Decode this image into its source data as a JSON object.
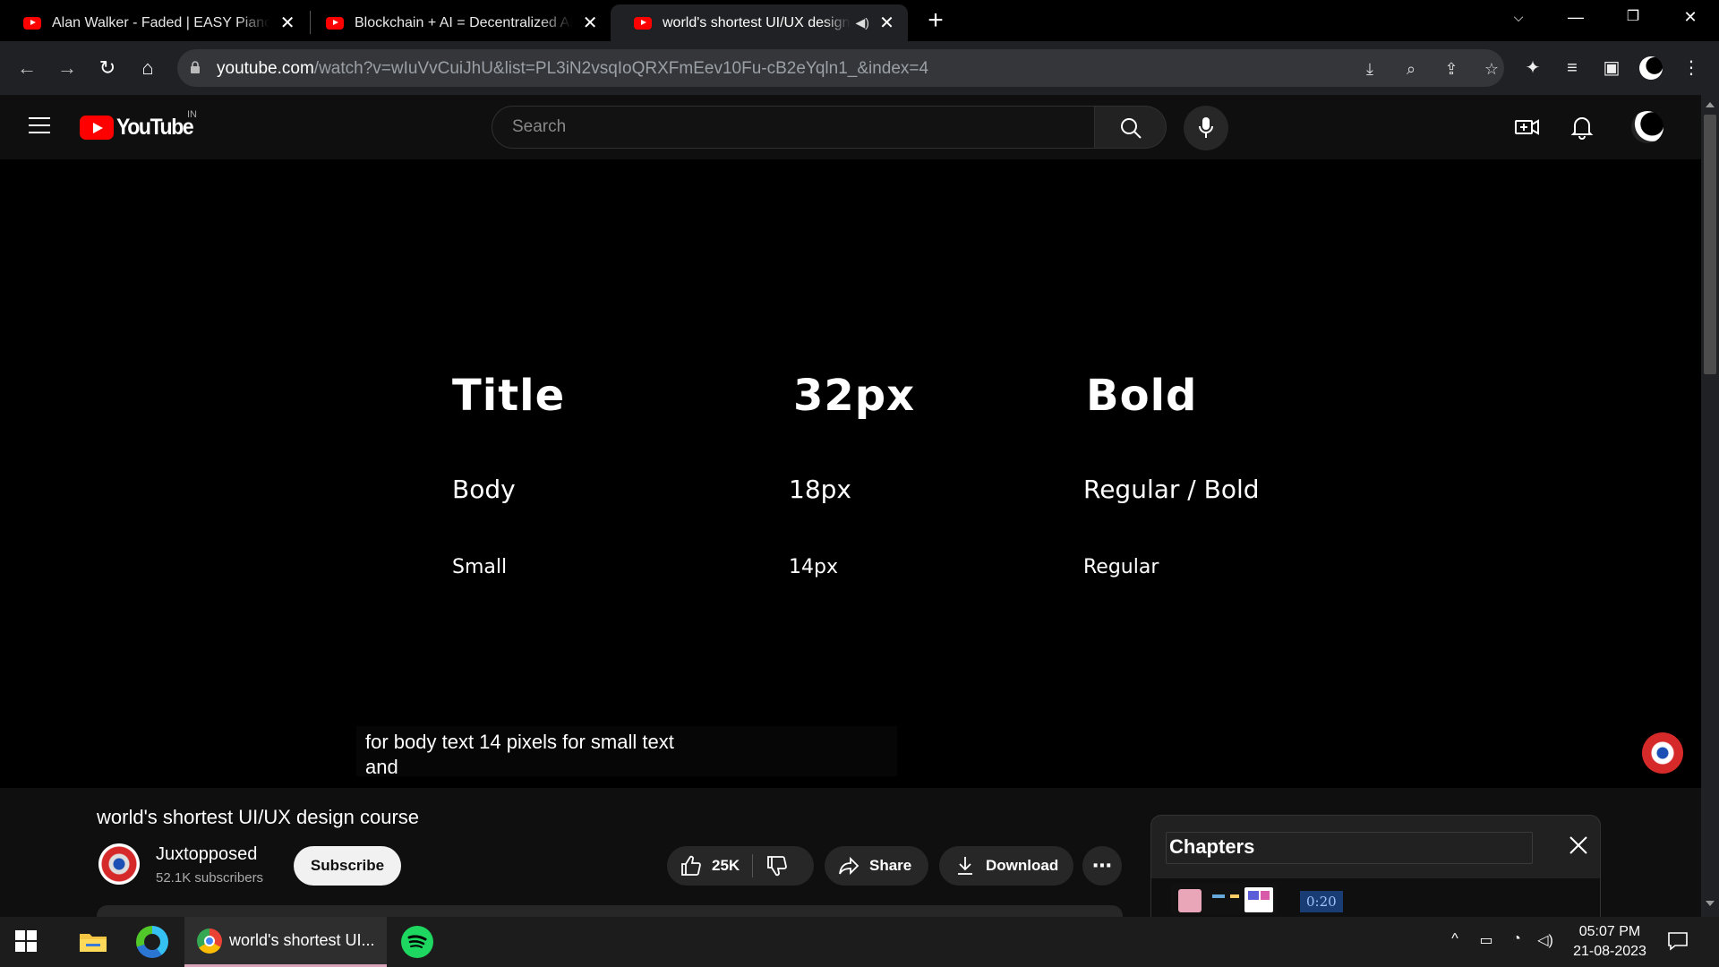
{
  "browser": {
    "tabs": [
      {
        "label": "Alan Walker - Faded | EASY Piano"
      },
      {
        "label": "Blockchain + AI = Decentralized AI"
      },
      {
        "label": "world's shortest UI/UX design course"
      }
    ],
    "url_host": "youtube.com",
    "url_path": "/watch?v=wIuVvCuiJhU&list=PL3iN2vsqIoQRXFmEev10Fu-cB2eYqln1_&index=4"
  },
  "youtube": {
    "country_code": "IN",
    "search_placeholder": "Search"
  },
  "video_frame": {
    "rows": [
      {
        "role": "Title",
        "size": "32px",
        "weight": "Bold"
      },
      {
        "role": "Body",
        "size": "18px",
        "weight": "Regular / Bold"
      },
      {
        "role": "Small",
        "size": "14px",
        "weight": "Regular"
      }
    ],
    "caption_line1": "for body text 14 pixels for small text",
    "caption_line2": "and"
  },
  "video_info": {
    "title": "world's shortest UI/UX design course",
    "channel": "Juxtopposed",
    "subscribers": "52.1K subscribers",
    "subscribe_label": "Subscribe",
    "likes": "25K",
    "share_label": "Share",
    "download_label": "Download"
  },
  "chapters": {
    "heading": "Chapters",
    "first_time": "0:20"
  },
  "taskbar": {
    "active_app_label": "world's shortest UI...",
    "time": "05:07 PM",
    "date": "21-08-2023"
  }
}
